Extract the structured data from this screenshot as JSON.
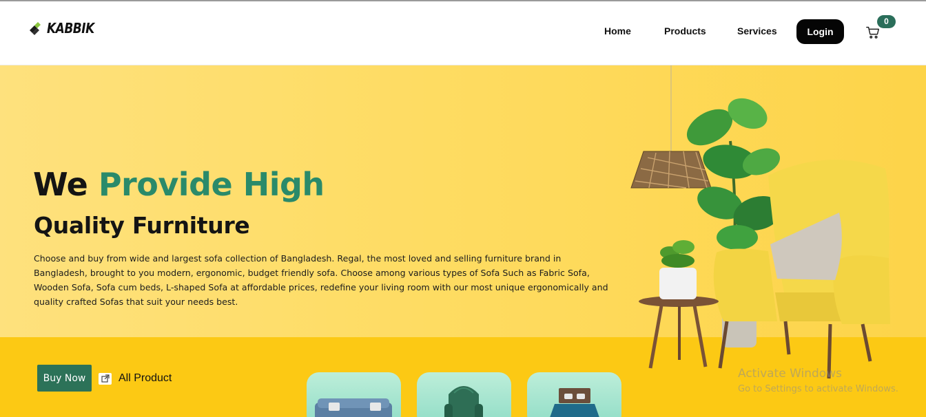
{
  "brand": {
    "name": "KABBIK",
    "logo_icon": "kabbik-logo-icon"
  },
  "nav": {
    "home": "Home",
    "products": "Products",
    "services": "Services",
    "login": "Login",
    "cart_icon": "cart-icon",
    "cart_count": "0"
  },
  "hero": {
    "headline_part1": "We ",
    "headline_accent": "Provide High",
    "headline_line2": "Quality Furniture",
    "description": "Choose and buy from wide and largest sofa collection of Bangladesh. Regal, the most loved and selling furniture brand in Bangladesh, brought to you modern, ergonomic, budget friendly sofa. Choose among various types of Sofa Such as Fabric Sofa, Wooden Sofa, Sofa cum beds, L-shaped Sofa at affordable prices, redefine your living room with our most unique ergonomically and quality crafted Sofas that suit your needs best.",
    "buy_now": "Buy Now",
    "all_product": "All Product",
    "all_product_icon": "external-link-icon",
    "thumbnails": [
      "sofa-thumbnail",
      "armchair-thumbnail",
      "bed-thumbnail"
    ]
  },
  "colors": {
    "accent_green": "#2a8a6a",
    "button_green": "#2c7258",
    "hero_yellow": "#fedc63",
    "hero_bottom_yellow": "#fcc914",
    "login_bg": "#050505"
  },
  "watermark": {
    "line1": "Activate Windows",
    "line2": "Go to Settings to activate Windows."
  }
}
